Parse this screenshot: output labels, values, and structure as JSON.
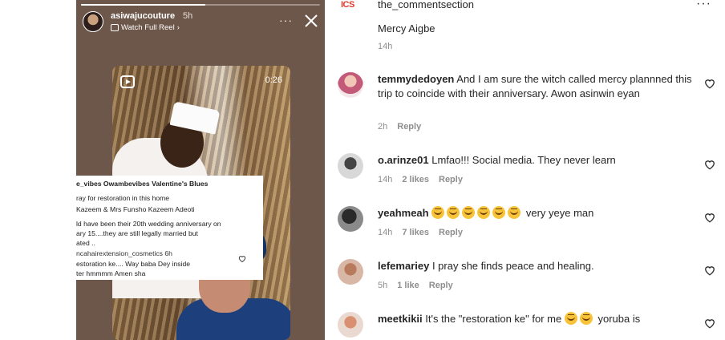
{
  "story": {
    "username": "asiwajucouture",
    "time": "5h",
    "watch_label": "Watch Full Reel",
    "chevron": "›",
    "more_label": "···",
    "progress": 0.52,
    "video_duration": "0:26",
    "card": {
      "line1_bold": "e_vibes Owambevibes Valentine's Blues",
      "line2": "ray for restoration in this home",
      "line3": "Kazeem & Mrs Funsho Kazeem Adeoti",
      "line4": "ld have been their 20th wedding anniversary on",
      "line5": "ary 15....they are still legally married but",
      "line6": "ated ..",
      "line7": "ncahairextension_cosmetics 6h",
      "line8": "estoration ke.... Way baba Dey inside",
      "line9": "ter hmmmm Amen sha"
    }
  },
  "header": {
    "logo_text": "ICS",
    "username": "the_commentsection",
    "more_label": "···"
  },
  "cut_comment": {
    "text": "Mercy Aigbe",
    "time": "14h"
  },
  "comments": [
    {
      "username": "temmydedoyen",
      "text": "And I am sure the witch called mercy plannned this trip to coincide with their anniversary. Awon asinwin eyan",
      "time": "2h",
      "likes": "",
      "reply": "Reply"
    },
    {
      "username": "o.arinze01",
      "text": "Lmfao!!! Social media. They never learn",
      "time": "14h",
      "likes": "2 likes",
      "reply": "Reply"
    },
    {
      "username": "yeahmeah",
      "text": "very yeye man",
      "emoji_count": 6,
      "time": "14h",
      "likes": "7 likes",
      "reply": "Reply"
    },
    {
      "username": "lefemariey",
      "text": "I pray she finds peace and healing.",
      "time": "5h",
      "likes": "1 like",
      "reply": "Reply"
    },
    {
      "username": "meetkikii",
      "text_before": "It's the \"restoration ke\" for me",
      "text_after": "yoruba is"
    }
  ],
  "colors": {
    "story_bg": "#6d574a",
    "meta_gray": "#8e8e8e",
    "text": "#262626",
    "emoji_yellow": "#f7c338",
    "logo_red": "#e33a2c"
  }
}
